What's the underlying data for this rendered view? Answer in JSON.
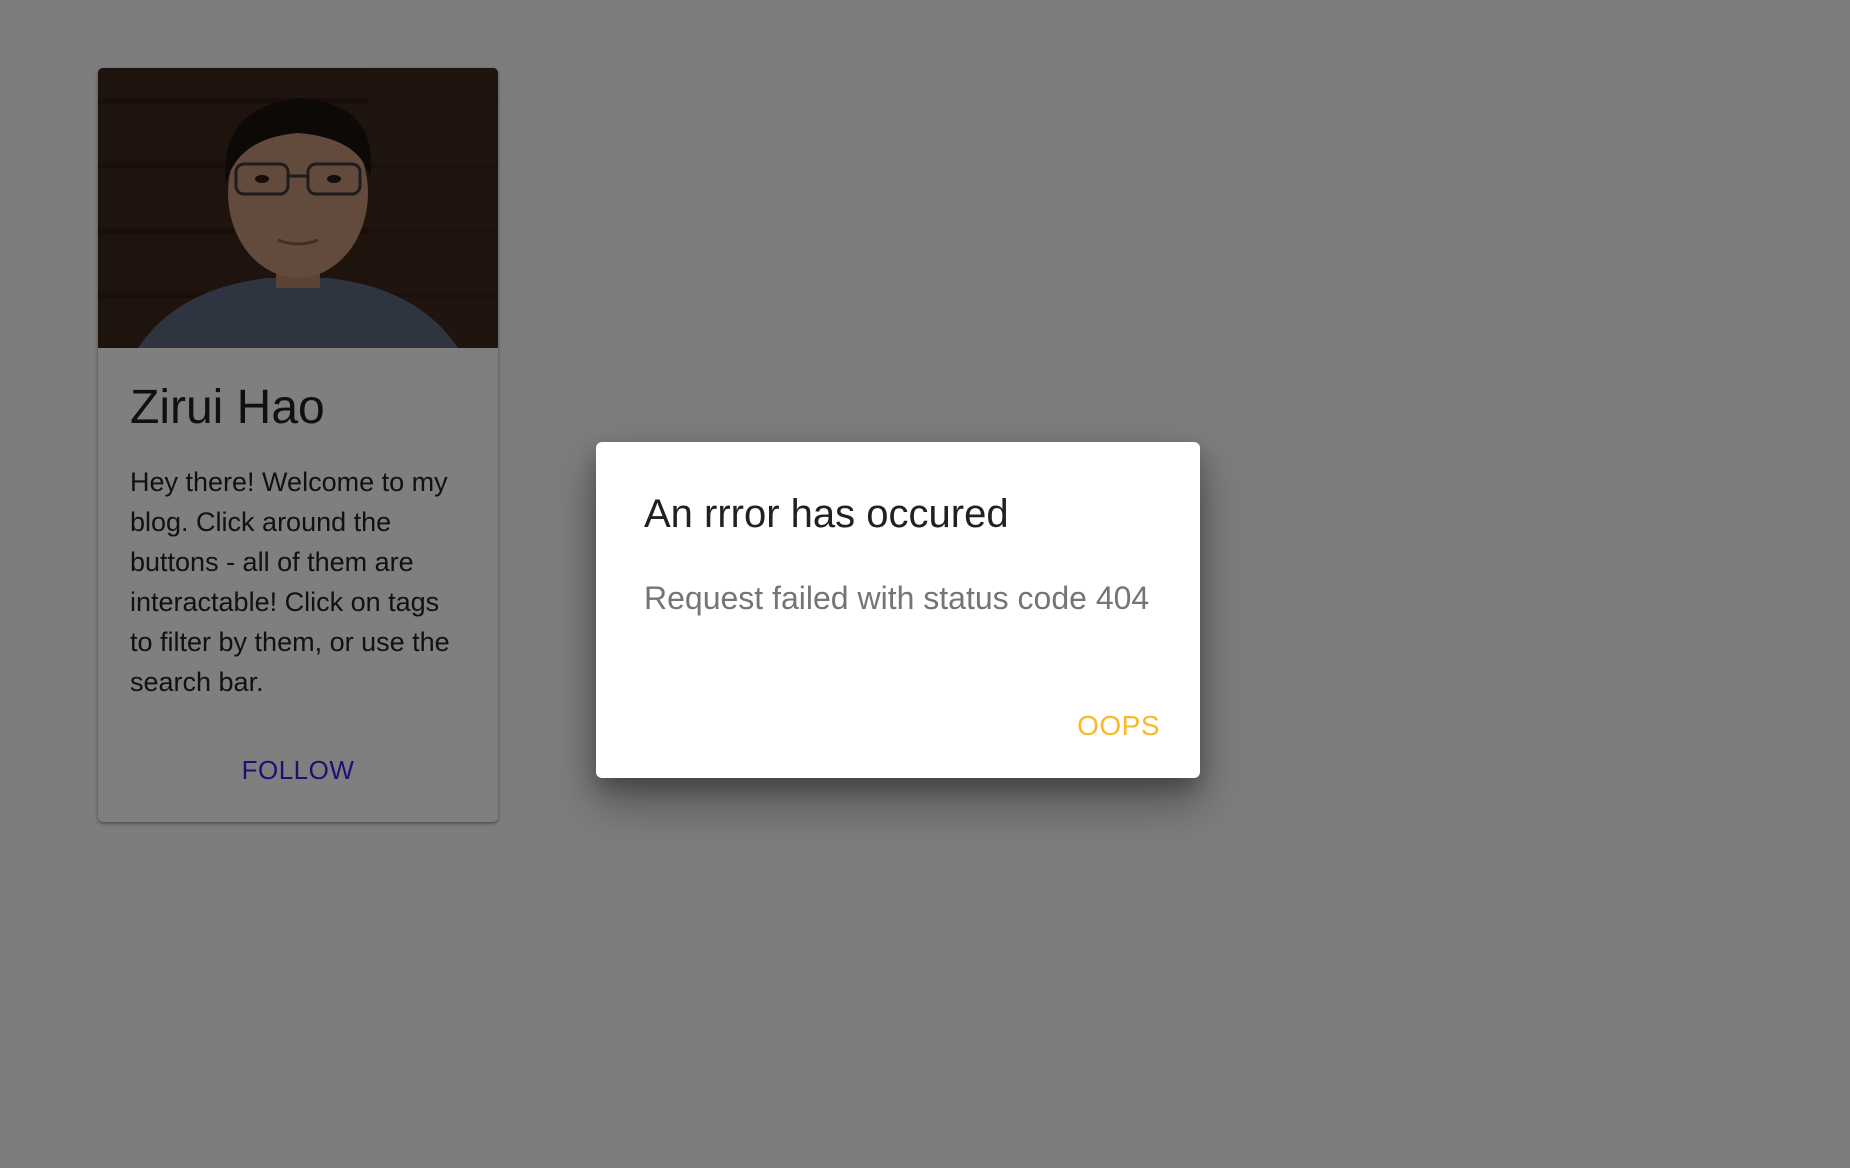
{
  "profile_card": {
    "name": "Zirui Hao",
    "bio": "Hey there! Welcome to my blog. Click around the buttons - all of them are interactable! Click on tags to filter by them, or use the search bar.",
    "follow_label": "FOLLOW",
    "photo_icon": "profile-photo"
  },
  "dialog": {
    "title": "An rrror has occured",
    "message": "Request failed with status code 404",
    "button_label": "OOPS"
  },
  "colors": {
    "follow_button": "#3d1ee6",
    "dialog_button": "#f9b825",
    "backdrop": "rgba(0,0,0,0.5)"
  }
}
